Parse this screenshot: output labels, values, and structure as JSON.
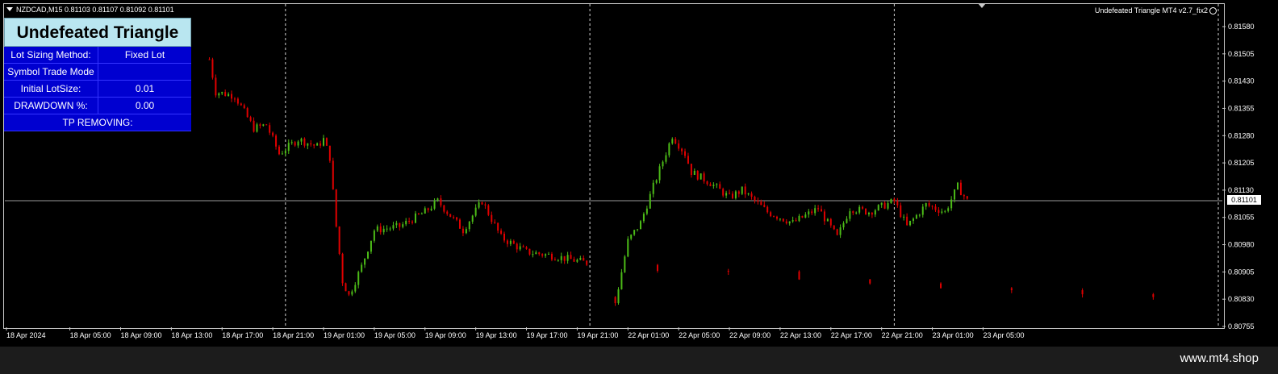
{
  "header": {
    "symbol_info": "NZDCAD,M15  0.81103 0.81107 0.81092 0.81101",
    "indicator_name": "Undefeated Triangle MT4 v2.7_fix2"
  },
  "panel": {
    "title": "Undefeated Triangle",
    "rows": [
      {
        "label": "Lot Sizing Method:",
        "value": "Fixed Lot"
      },
      {
        "label": "Symbol Trade Mode",
        "value": ""
      },
      {
        "label": "Initial LotSize:",
        "value": "0.01"
      },
      {
        "label": "DRAWDOWN %:",
        "value": "0.00"
      }
    ],
    "footer_label": "TP REMOVING:"
  },
  "current_price_label": "0.81101",
  "brand": "www.mt4.shop",
  "colors": {
    "bull": "#4cbb17",
    "bear": "#e00000",
    "grid": "#c8c8c8",
    "panel_bg": "#0000d0",
    "title_bg": "#b9e6f0"
  },
  "chart_data": {
    "type": "candlestick",
    "symbol": "NZDCAD",
    "timeframe": "M15",
    "y_ticks": [
      "0.81580",
      "0.81505",
      "0.81430",
      "0.81355",
      "0.81280",
      "0.81205",
      "0.81130",
      "0.81055",
      "0.80980",
      "0.80905",
      "0.80830",
      "0.80755"
    ],
    "ylim": [
      0.80755,
      0.8158
    ],
    "x_ticks": [
      "18 Apr 2024",
      "18 Apr 05:00",
      "18 Apr 09:00",
      "18 Apr 13:00",
      "18 Apr 17:00",
      "18 Apr 21:00",
      "19 Apr 01:00",
      "19 Apr 05:00",
      "19 Apr 09:00",
      "19 Apr 13:00",
      "19 Apr 17:00",
      "19 Apr 21:00",
      "22 Apr 01:00",
      "22 Apr 05:00",
      "22 Apr 09:00",
      "22 Apr 13:00",
      "22 Apr 17:00",
      "22 Apr 21:00",
      "23 Apr 01:00",
      "23 Apr 05:00"
    ],
    "current_price": 0.81101,
    "session_separators": [
      "18 Apr 22:00",
      "19 Apr 22:00",
      "22 Apr 22:00"
    ],
    "close_path": [
      {
        "t": "18 Apr 16:00",
        "p": 0.8149
      },
      {
        "t": "18 Apr 16:30",
        "p": 0.814
      },
      {
        "t": "18 Apr 18:00",
        "p": 0.8139
      },
      {
        "t": "18 Apr 19:30",
        "p": 0.813
      },
      {
        "t": "18 Apr 20:30",
        "p": 0.8131
      },
      {
        "t": "18 Apr 21:30",
        "p": 0.8123
      },
      {
        "t": "18 Apr 23:00",
        "p": 0.8127
      },
      {
        "t": "19 Apr 00:30",
        "p": 0.8125
      },
      {
        "t": "19 Apr 01:00",
        "p": 0.8127
      },
      {
        "t": "19 Apr 01:30",
        "p": 0.8122
      },
      {
        "t": "19 Apr 02:00",
        "p": 0.8103
      },
      {
        "t": "19 Apr 02:30",
        "p": 0.8088
      },
      {
        "t": "19 Apr 03:00",
        "p": 0.8084
      },
      {
        "t": "19 Apr 04:00",
        "p": 0.8092
      },
      {
        "t": "19 Apr 05:00",
        "p": 0.8102
      },
      {
        "t": "19 Apr 07:00",
        "p": 0.8103
      },
      {
        "t": "19 Apr 09:00",
        "p": 0.8107
      },
      {
        "t": "19 Apr 10:00",
        "p": 0.811
      },
      {
        "t": "19 Apr 12:00",
        "p": 0.8102
      },
      {
        "t": "19 Apr 13:30",
        "p": 0.811
      },
      {
        "t": "19 Apr 15:00",
        "p": 0.81
      },
      {
        "t": "19 Apr 17:00",
        "p": 0.8096
      },
      {
        "t": "19 Apr 19:00",
        "p": 0.8095
      },
      {
        "t": "19 Apr 21:45",
        "p": 0.8093
      },
      {
        "t": "22 Apr 00:00",
        "p": 0.8082
      },
      {
        "t": "22 Apr 01:00",
        "p": 0.8099
      },
      {
        "t": "22 Apr 02:00",
        "p": 0.8104
      },
      {
        "t": "22 Apr 03:00",
        "p": 0.8114
      },
      {
        "t": "22 Apr 04:30",
        "p": 0.8128
      },
      {
        "t": "22 Apr 05:30",
        "p": 0.8123
      },
      {
        "t": "22 Apr 06:00",
        "p": 0.8118
      },
      {
        "t": "22 Apr 07:30",
        "p": 0.8115
      },
      {
        "t": "22 Apr 09:00",
        "p": 0.8111
      },
      {
        "t": "22 Apr 10:00",
        "p": 0.8113
      },
      {
        "t": "22 Apr 12:00",
        "p": 0.8107
      },
      {
        "t": "22 Apr 14:00",
        "p": 0.8104
      },
      {
        "t": "22 Apr 16:00",
        "p": 0.8108
      },
      {
        "t": "22 Apr 17:30",
        "p": 0.81
      },
      {
        "t": "22 Apr 18:30",
        "p": 0.8108
      },
      {
        "t": "22 Apr 20:00",
        "p": 0.8107
      },
      {
        "t": "22 Apr 22:00",
        "p": 0.811
      },
      {
        "t": "22 Apr 23:00",
        "p": 0.8103
      },
      {
        "t": "23 Apr 00:30",
        "p": 0.8109
      },
      {
        "t": "23 Apr 02:00",
        "p": 0.8107
      },
      {
        "t": "23 Apr 03:00",
        "p": 0.8114
      },
      {
        "t": "23 Apr 03:45",
        "p": 0.81101
      }
    ]
  }
}
